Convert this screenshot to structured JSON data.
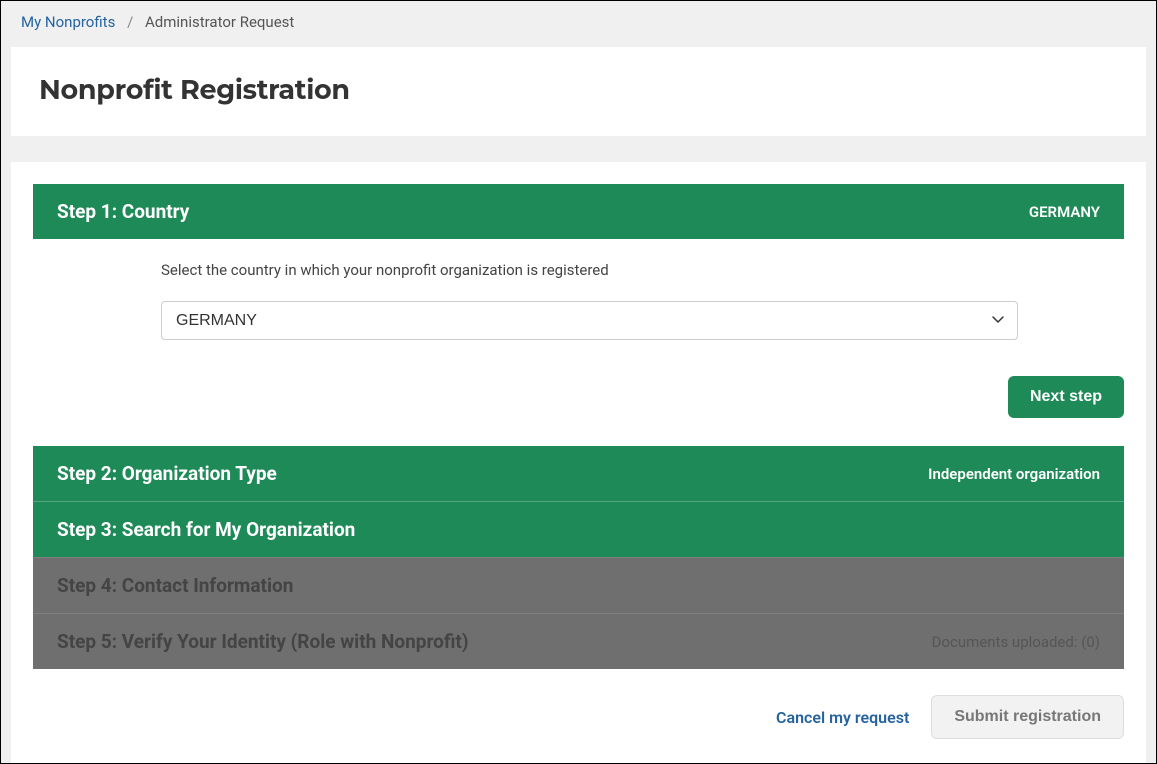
{
  "breadcrumb": {
    "root": "My Nonprofits",
    "separator": "/",
    "current": "Administrator Request"
  },
  "page_title": "Nonprofit Registration",
  "steps": {
    "step1": {
      "title": "Step 1: Country",
      "summary": "GERMANY"
    },
    "step2": {
      "title": "Step 2: Organization Type",
      "summary": "Independent organization"
    },
    "step3": {
      "title": "Step 3: Search for My Organization",
      "summary": ""
    },
    "step4": {
      "title": "Step 4: Contact Information",
      "summary": ""
    },
    "step5": {
      "title": "Step 5: Verify Your Identity (Role with Nonprofit)",
      "summary": "Documents uploaded: (0)"
    }
  },
  "step1_body": {
    "description": "Select the country in which your nonprofit organization is registered",
    "selected_country": "GERMANY"
  },
  "buttons": {
    "next_step": "Next step",
    "cancel": "Cancel my request",
    "submit": "Submit registration"
  }
}
